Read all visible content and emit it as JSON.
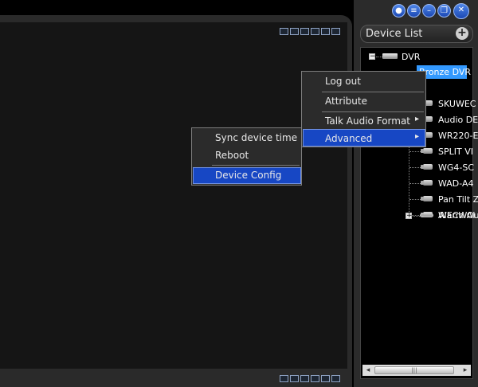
{
  "right_panel": {
    "device_list_title": "Device List",
    "add_symbol": "+",
    "window_buttons": [
      "lock-icon",
      "list-icon",
      "minimize-icon",
      "restore-icon",
      "close-icon"
    ]
  },
  "tree": {
    "root": {
      "label": "DVR",
      "expander": "−"
    },
    "selected_device": "Bronze DVR",
    "channels": [
      "SKUWEC",
      "Audio DE",
      "WR220-E",
      "SPLIT VI",
      "WG4-SC",
      "WAD-A4",
      "Pan Tilt Z",
      "WECWAI"
    ],
    "alarm": {
      "label": "Alarm Ou",
      "expander": "+"
    }
  },
  "context_menu": {
    "items": [
      "Log out",
      "Attribute",
      "Talk Audio Format",
      "Advanced"
    ],
    "submenu_arrow": "▸"
  },
  "submenu": {
    "items": [
      "Sync device time",
      "Reboot",
      "Device Config"
    ]
  },
  "scrollbar": {
    "left": "◂",
    "right": "▸",
    "grip": "|||"
  }
}
